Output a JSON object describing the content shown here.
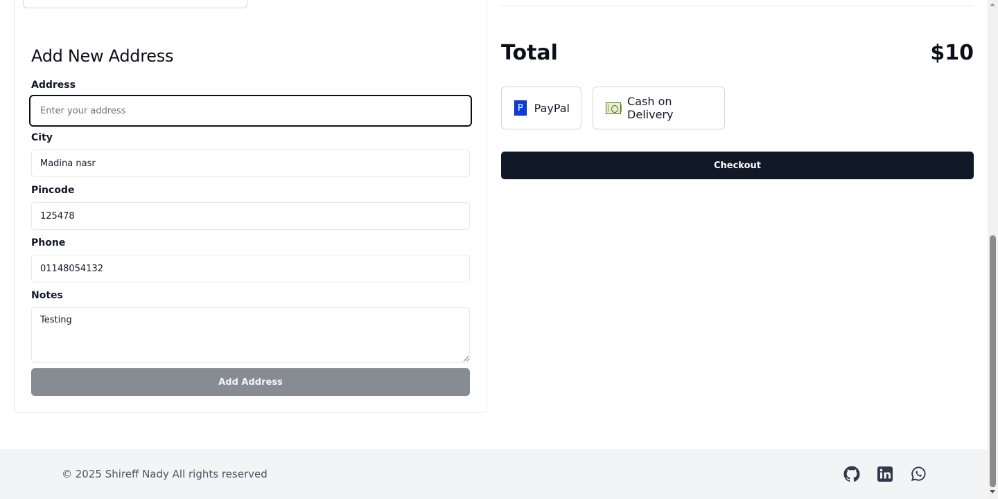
{
  "address_form": {
    "title": "Add New Address",
    "address_label": "Address",
    "address_placeholder": "Enter your address",
    "address_value": "",
    "city_label": "City",
    "city_value": "Madina nasr",
    "pincode_label": "Pincode",
    "pincode_value": "125478",
    "phone_label": "Phone",
    "phone_value": "01148054132",
    "notes_label": "Notes",
    "notes_value": "Testing",
    "submit_label": "Add Address"
  },
  "summary": {
    "total_label": "Total",
    "total_value": "$10"
  },
  "payment": {
    "options": [
      {
        "label": "PayPal",
        "icon": "paypal-icon"
      },
      {
        "label": "Cash on Delivery",
        "icon": "cash-icon"
      }
    ]
  },
  "checkout": {
    "label": "Checkout"
  },
  "footer": {
    "copyright": "© 2025 Shireff Nady All rights reserved",
    "social": [
      "github-icon",
      "linkedin-icon",
      "whatsapp-icon"
    ]
  },
  "colors": {
    "primary_dark": "#111827",
    "disabled_button": "#878b92",
    "footer_bg": "#f3f4f6",
    "border": "#e5e7eb"
  }
}
